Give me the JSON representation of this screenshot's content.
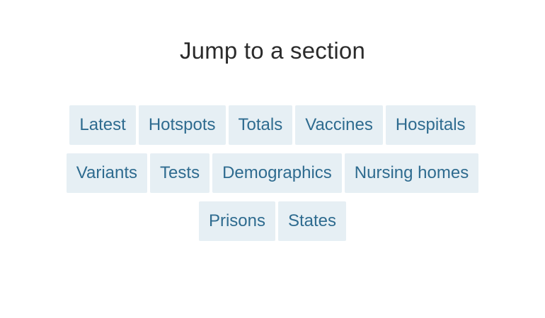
{
  "heading": "Jump to a section",
  "colors": {
    "chip_background": "#e6eff4",
    "chip_text": "#2e6b8f",
    "heading_text": "#2b2b2b"
  },
  "sections": {
    "row1": [
      "Latest",
      "Hotspots",
      "Totals",
      "Vaccines",
      "Hospitals"
    ],
    "row2": [
      "Variants",
      "Tests",
      "Demographics",
      "Nursing homes"
    ],
    "row3": [
      "Prisons",
      "States"
    ]
  }
}
